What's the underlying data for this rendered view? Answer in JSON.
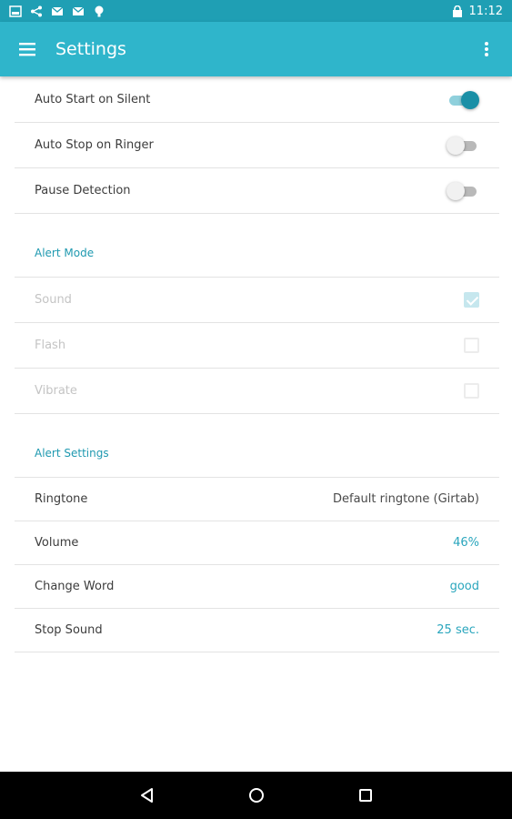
{
  "status_bar": {
    "time": "11:12",
    "icons_left": [
      "image-icon",
      "share-icon",
      "mail-icon",
      "mail-icon",
      "bulb-icon"
    ],
    "icons_right": [
      "lock-icon"
    ]
  },
  "app_bar": {
    "title": "Settings",
    "menu_icon": "hamburger-menu-icon",
    "overflow_icon": "more-vert-icon"
  },
  "toggles": [
    {
      "label": "Auto Start on Silent",
      "checked": true
    },
    {
      "label": "Auto Stop on Ringer",
      "checked": false
    },
    {
      "label": "Pause Detection",
      "checked": false
    }
  ],
  "alert_mode": {
    "header": "Alert Mode",
    "items": [
      {
        "label": "Sound",
        "checked": true
      },
      {
        "label": "Flash",
        "checked": false
      },
      {
        "label": "Vibrate",
        "checked": false
      }
    ]
  },
  "alert_settings": {
    "header": "Alert Settings",
    "items": [
      {
        "label": "Ringtone",
        "value": "Default ringtone (Girtab)"
      },
      {
        "label": "Volume",
        "value": "46%"
      },
      {
        "label": "Change Word",
        "value": "good"
      },
      {
        "label": "Stop Sound",
        "value": "25 sec."
      }
    ]
  },
  "nav_bar": {
    "buttons": [
      "back-icon",
      "home-icon",
      "recents-icon"
    ]
  },
  "colors": {
    "status_bar": "#1f9fb4",
    "app_bar": "#2fb5cb",
    "accent": "#2aa6bd",
    "nav_bar": "#000000"
  }
}
